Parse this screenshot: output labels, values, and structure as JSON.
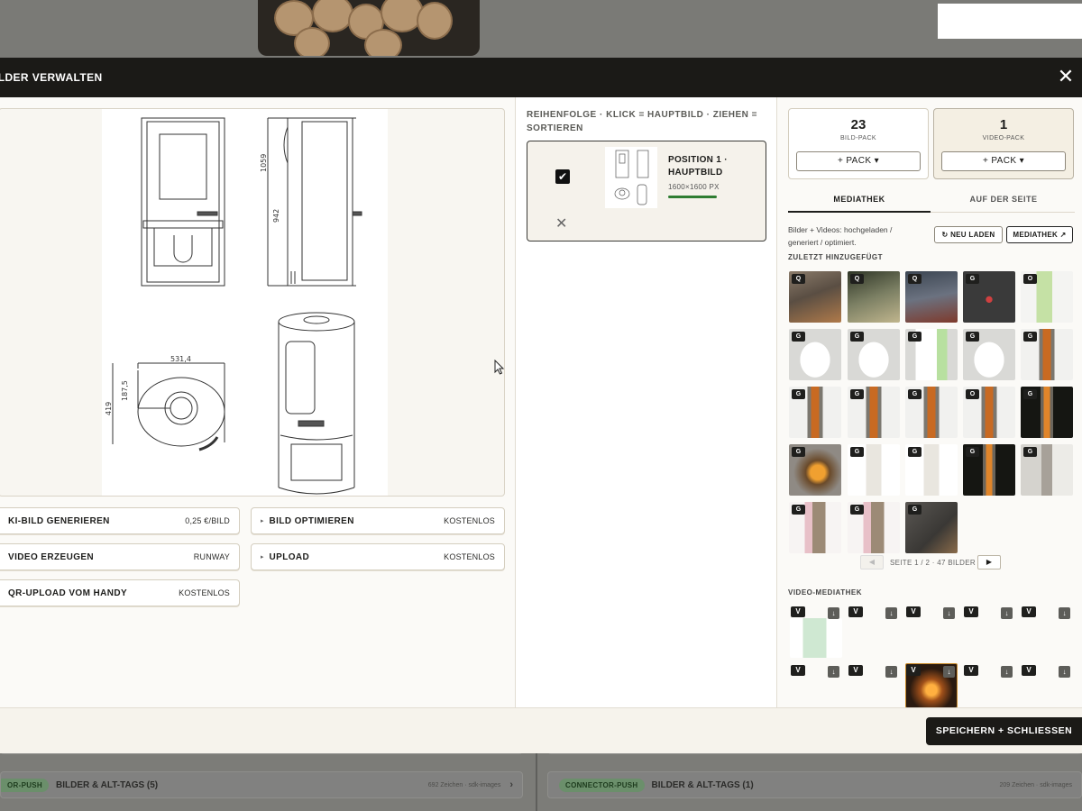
{
  "modal": {
    "title": "ILDER VERWALTEN",
    "close_glyph": "✕"
  },
  "left": {
    "actions": [
      {
        "label": "KI-BILD GENERIEREN",
        "price": "0,25 €/BILD"
      },
      {
        "label": "BILD OPTIMIEREN",
        "price": "KOSTENLOS",
        "caret": "▸"
      },
      {
        "label": "VIDEO ERZEUGEN",
        "price": "RUNWAY"
      },
      {
        "label": "UPLOAD",
        "price": "KOSTENLOS",
        "caret": "▸"
      },
      {
        "label": "QR-UPLOAD VOM HANDY",
        "price": "KOSTENLOS"
      }
    ],
    "drawing_dims": [
      "531,4",
      "187,5",
      "419",
      "1059",
      "942"
    ]
  },
  "middle": {
    "heading": "REIHENFOLGE · KLICK = HAUPTBILD · ZIEHEN = SORTIEREN",
    "position": {
      "title": "POSITION 1 · HAUPTBILD",
      "size": "1600×1600 PX",
      "checked_glyph": "✔",
      "remove_glyph": "✕"
    }
  },
  "right": {
    "packs": [
      {
        "count": "23",
        "label": "BILD-PACK",
        "button": "+ PACK ▾"
      },
      {
        "count": "1",
        "label": "VIDEO-PACK",
        "button": "+ PACK ▾"
      }
    ],
    "tabs": [
      "MEDIATHEK",
      "AUF DER SEITE"
    ],
    "description": "Bilder + Videos: hochgeladen / generiert / optimiert.",
    "reload_button": "↻ NEU LADEN",
    "mediathek_button": "MEDIATHEK ↗",
    "recent_label": "ZULETZT HINZUGEFÜGT",
    "thumbs": [
      {
        "badge": "Q",
        "kind": "sofa-photo"
      },
      {
        "badge": "Q",
        "kind": "table-photo"
      },
      {
        "badge": "Q",
        "kind": "room-photo"
      },
      {
        "badge": "G",
        "kind": "bicycle-photo"
      },
      {
        "badge": "O",
        "kind": "bottle-photo"
      },
      {
        "badge": "G",
        "kind": "bucket-photo"
      },
      {
        "badge": "G",
        "kind": "bucket-photo"
      },
      {
        "badge": "G",
        "kind": "bucket-bottle-photo"
      },
      {
        "badge": "G",
        "kind": "bucket-photo"
      },
      {
        "badge": "G",
        "kind": "stove-photo"
      },
      {
        "badge": "G",
        "kind": "stove-photo"
      },
      {
        "badge": "G",
        "kind": "stove-photo"
      },
      {
        "badge": "G",
        "kind": "stove-photo"
      },
      {
        "badge": "O",
        "kind": "stove-photo"
      },
      {
        "badge": "G",
        "kind": "stove-dark-photo"
      },
      {
        "badge": "G",
        "kind": "fireplace-photo"
      },
      {
        "badge": "G",
        "kind": "stove-white-photo"
      },
      {
        "badge": "G",
        "kind": "stove-white-photo"
      },
      {
        "badge": "G",
        "kind": "stove-dark-photo"
      },
      {
        "badge": "G",
        "kind": "interior-photo"
      },
      {
        "badge": "G",
        "kind": "pink-room-photo"
      },
      {
        "badge": "G",
        "kind": "pink-room-photo"
      },
      {
        "badge": "G",
        "kind": "plate-photo"
      }
    ],
    "pager": {
      "prev": "◀",
      "text": "SEITE 1 / 2 · 47 BILDER",
      "next": "▶"
    },
    "video_label": "VIDEO-MEDIATHEK",
    "video_badge": "V",
    "download_glyph": "↓"
  },
  "footer": {
    "save_button": "SPEICHERN + SCHLIESSEN"
  },
  "background": {
    "rows": [
      {
        "pill": "OR-PUSH",
        "label": "BILDER & ALT-TAGS (5)",
        "meta": "692 Zeichen · sdk-images"
      },
      {
        "pill": "CONNECTOR-PUSH",
        "label": "BILDER & ALT-TAGS (1)",
        "meta": "209 Zeichen · sdk-images"
      }
    ],
    "chevron": "›"
  }
}
